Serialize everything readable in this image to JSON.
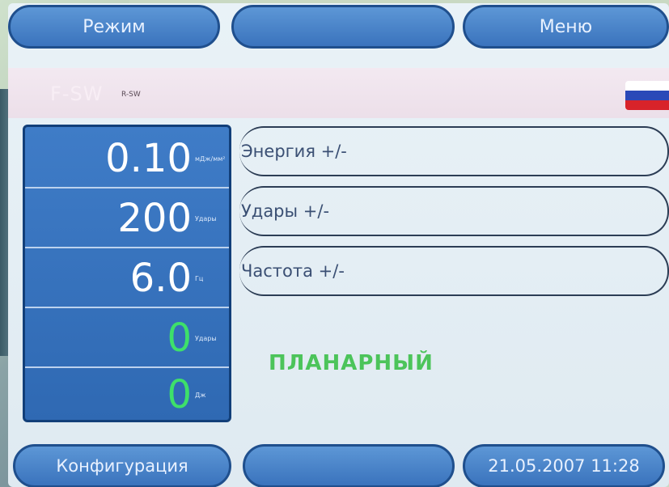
{
  "top": {
    "mode_button": "Режим",
    "middle_button": "",
    "menu_button": "Меню"
  },
  "header": {
    "mode_name": "F-SW",
    "mode_sub": "R-SW"
  },
  "values": [
    {
      "value": "0.10",
      "unit": "мДж/мм²",
      "color": "white"
    },
    {
      "value": "200",
      "unit": "Удары",
      "color": "white"
    },
    {
      "value": "6.0",
      "unit": "Гц",
      "color": "white"
    },
    {
      "value": "0",
      "unit": "Удары",
      "color": "green"
    },
    {
      "value": "0",
      "unit": "Дж",
      "color": "green"
    }
  ],
  "params": [
    {
      "label": "Энергия +/-"
    },
    {
      "label": "Удары +/-"
    },
    {
      "label": "Частота +/-"
    }
  ],
  "status": {
    "planar": "ПЛАНАРНЫЙ"
  },
  "bottom": {
    "config_button": "Конфигурация",
    "middle_button": "",
    "datetime": "21.05.2007 11:28"
  },
  "colors": {
    "button_blue": "#3a73bd",
    "panel_blue": "#2f69b3",
    "green_text": "#4cc45a"
  }
}
